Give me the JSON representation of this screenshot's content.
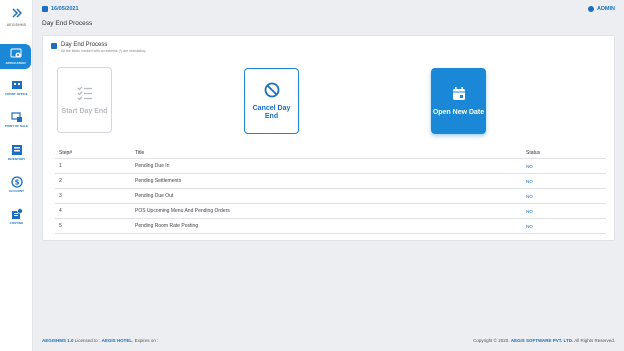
{
  "app": {
    "logo_text": "AEGISHMS"
  },
  "sidebar": {
    "items": [
      {
        "label": "APPLICATION",
        "icon": "app-settings-icon",
        "active": true
      },
      {
        "label": "FRONT OFFICE",
        "icon": "front-office-icon",
        "active": false
      },
      {
        "label": "POINT OF SALE",
        "icon": "pos-icon",
        "active": false
      },
      {
        "label": "INVENTORY",
        "icon": "inventory-icon",
        "active": false
      },
      {
        "label": "ACCOUNT",
        "icon": "account-icon",
        "active": false
      },
      {
        "label": "COSTING",
        "icon": "costing-icon",
        "active": false
      }
    ]
  },
  "topbar": {
    "date": "16/05/2021",
    "user": "ADMIN"
  },
  "page": {
    "title": "Day End Process"
  },
  "card": {
    "title": "Day End Process",
    "subtitle": "All the fields marked with an asterisk (*) are mandatory"
  },
  "actions": {
    "start": "Start Day End",
    "cancel": "Cancel Day End",
    "open": "Open New Date"
  },
  "table": {
    "headers": {
      "step": "Step#",
      "title": "Title",
      "status": "Status"
    },
    "rows": [
      {
        "step": "1",
        "title": "Pending Due In",
        "status": "NO"
      },
      {
        "step": "2",
        "title": "Pending Settlements",
        "status": "NO"
      },
      {
        "step": "3",
        "title": "Pending Due Out",
        "status": "NO"
      },
      {
        "step": "4",
        "title": "POS Upcoming Menu And Pending Orders",
        "status": "NO"
      },
      {
        "step": "5",
        "title": "Pending Room Rate Posting",
        "status": "NO"
      }
    ]
  },
  "footer": {
    "product": "AEGISHMS 1.0",
    "licensed_prefix": "Licensed to :",
    "licensee": "AEGIS HOTEL",
    "expires": "Expires on :",
    "copyright_prefix": "Copyright © 2020.",
    "company": "AEGIS SOFTWARE PVT. LTD.",
    "rights": "All Rights Reserved."
  },
  "colors": {
    "accent": "#1a88d6",
    "brand": "#1a6fc0",
    "background": "#eceef1"
  }
}
